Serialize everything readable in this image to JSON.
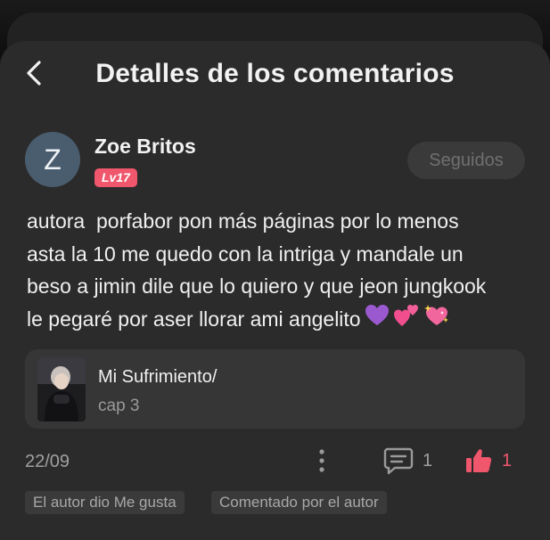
{
  "header": {
    "title": "Detalles de los comentarios"
  },
  "author": {
    "avatar_letter": "Z",
    "name": "Zoe Britos",
    "level": "Lv17",
    "follow_label": "Seguidos"
  },
  "comment": {
    "lines": [
      "autora  porfabor pon más páginas por lo menos",
      "asta la 10 me quedo con la intriga y mandale un",
      "beso a jimin dile que lo quiero y que jeon jungkook",
      "le pegaré por aser llorar ami angelito"
    ],
    "emojis": [
      "purple-heart",
      "two-hearts",
      "sparkling-heart"
    ]
  },
  "story": {
    "title": "Mi Sufrimiento/",
    "chapter": "cap 3"
  },
  "footer": {
    "date": "22/09",
    "reply_count": "1",
    "like_count": "1"
  },
  "tags": {
    "author_liked": "El autor dio Me gusta",
    "author_commented": "Comentado por el autor"
  },
  "colors": {
    "accent": "#f0566c",
    "background": "#2b2b2b",
    "text": "#f0f0f0"
  }
}
